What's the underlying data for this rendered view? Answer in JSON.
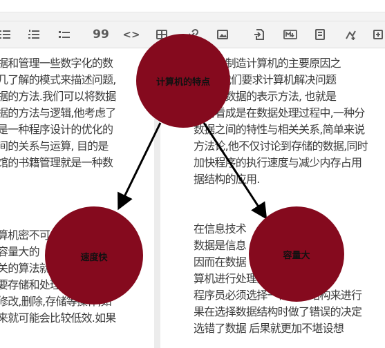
{
  "toolbar": {
    "buttons": [
      {
        "icon": "unordered-list-icon"
      },
      {
        "icon": "ordered-list-icon"
      },
      {
        "icon": "task-list-icon"
      },
      {
        "icon": "quote-icon",
        "label": "99"
      },
      {
        "icon": "code-icon",
        "label": "<>"
      },
      {
        "icon": "table-icon"
      },
      {
        "icon": "link-icon"
      },
      {
        "icon": "image-icon"
      },
      {
        "icon": "import-icon"
      },
      {
        "icon": "markdown-export-icon"
      },
      {
        "icon": "preview-icon"
      },
      {
        "icon": "add-chart-icon"
      },
      {
        "icon": "more-icon"
      }
    ]
  },
  "left_pane": {
    "paragraph1": [
      "据和管理一些数字化的数",
      "几了解的模式来描述问题,",
      "据的方法.我们可以将数据",
      "据的方法与逻辑,他考虑了",
      "是一种程序设计的优化的",
      "间的关系与运算, 目的是",
      "馆的书籍管理就是一种数"
    ],
    "paragraph2": [
      "算机密不可",
      "容量大的",
      "关的算法就",
      "要存储和处理的数据,",
      "修改,删除,存储等操作,如",
      "来就可能会比较低效.如果"
    ]
  },
  "right_pane": {
    "paragraph1": [
      "设计和制造计算机的主要原因之",
      "息. 当我们要求计算机解决问题",
      "结构是数据的表示方法, 也就是",
      "结构看成是在数据处理过程中,一种分",
      "数据之间的特性与相关关系,简单来说",
      "方法论,他不仅讨论到存储的数据,同时",
      "加快程序的执行速度与减少内存占用",
      "据结构的应用."
    ],
    "paragraph2": [
      "在信息技术",
      "数据是信息",
      "因而在数据",
      "算机进行处理的逻辑,在进行",
      "程序员必须选择一种数据结构来进行",
      "果在选择数据结构时做了错误的决定",
      "选错了数据  后果就更加不堪设想"
    ]
  },
  "mindmap": {
    "center": {
      "label": "计算机的特点",
      "color": "#850a1e"
    },
    "children": [
      {
        "label": "速度快",
        "color": "#850a1e"
      },
      {
        "label": "容量大",
        "color": "#850a1e"
      }
    ],
    "edge_color": "#000000"
  }
}
